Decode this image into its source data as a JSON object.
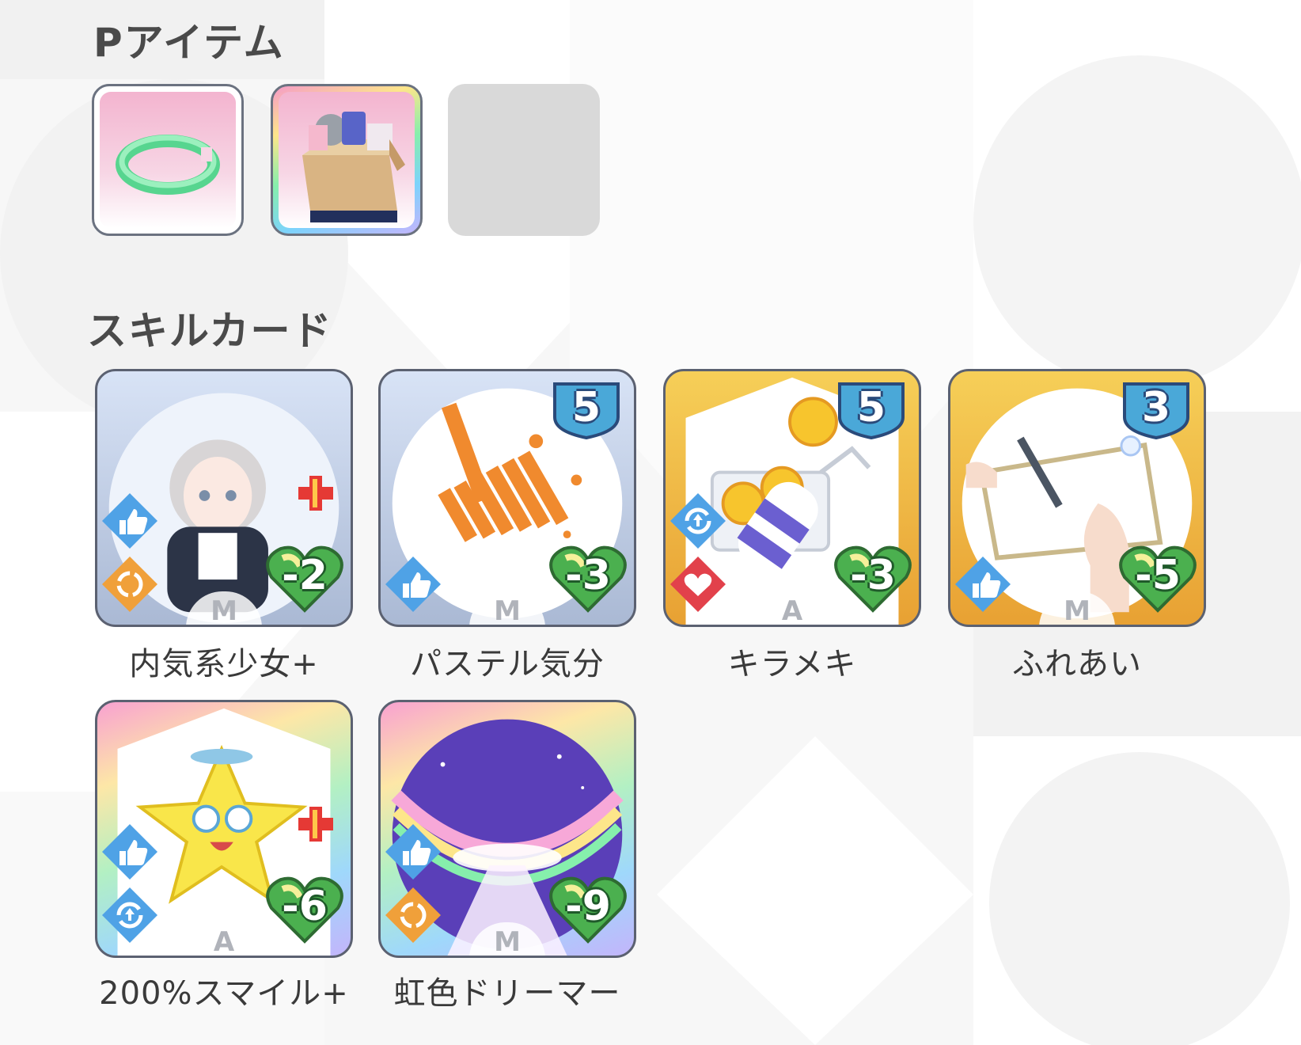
{
  "sections": {
    "items_title": "Pアイテム",
    "skills_title": "スキルカード"
  },
  "p_items": [
    {
      "name": "green-bracelet",
      "frame": "standard"
    },
    {
      "name": "goods-box",
      "frame": "rainbow"
    },
    {
      "name": "empty",
      "frame": "empty"
    }
  ],
  "cards": [
    {
      "label": "内気系少女+",
      "cost": "",
      "stamina": "-2",
      "type_mark": "M",
      "frame": "blue",
      "effects": [
        "thumbs-up-icon",
        "cycle-icon"
      ],
      "upgraded": true
    },
    {
      "label": "パステル気分",
      "cost": "5",
      "stamina": "-3",
      "type_mark": "M",
      "frame": "blue",
      "effects": [
        "thumbs-up-icon"
      ],
      "upgraded": false
    },
    {
      "label": "キラメキ",
      "cost": "5",
      "stamina": "-3",
      "type_mark": "A",
      "frame": "gold",
      "effects": [
        "boost-cycle-icon",
        "heart-break-icon"
      ],
      "upgraded": false
    },
    {
      "label": "ふれあい",
      "cost": "3",
      "stamina": "-5",
      "type_mark": "M",
      "frame": "gold",
      "effects": [
        "thumbs-up-icon"
      ],
      "upgraded": false
    },
    {
      "label": "200%スマイル+",
      "cost": "",
      "stamina": "-6",
      "type_mark": "A",
      "frame": "rainbow",
      "effects": [
        "thumbs-up-icon",
        "boost-cycle-icon"
      ],
      "upgraded": true
    },
    {
      "label": "虹色ドリーマー",
      "cost": "",
      "stamina": "-9",
      "type_mark": "M",
      "frame": "rainbow",
      "effects": [
        "thumbs-up-icon",
        "cycle-icon"
      ],
      "upgraded": false
    }
  ],
  "colors": {
    "background": "#f7f7f7",
    "frame_blue": "#aab9d4",
    "frame_gold": "#e8a133",
    "cost_badge": "#4aa8d8",
    "stamina_heart": "#4caf50",
    "upgrade_plus": "#e53935"
  }
}
